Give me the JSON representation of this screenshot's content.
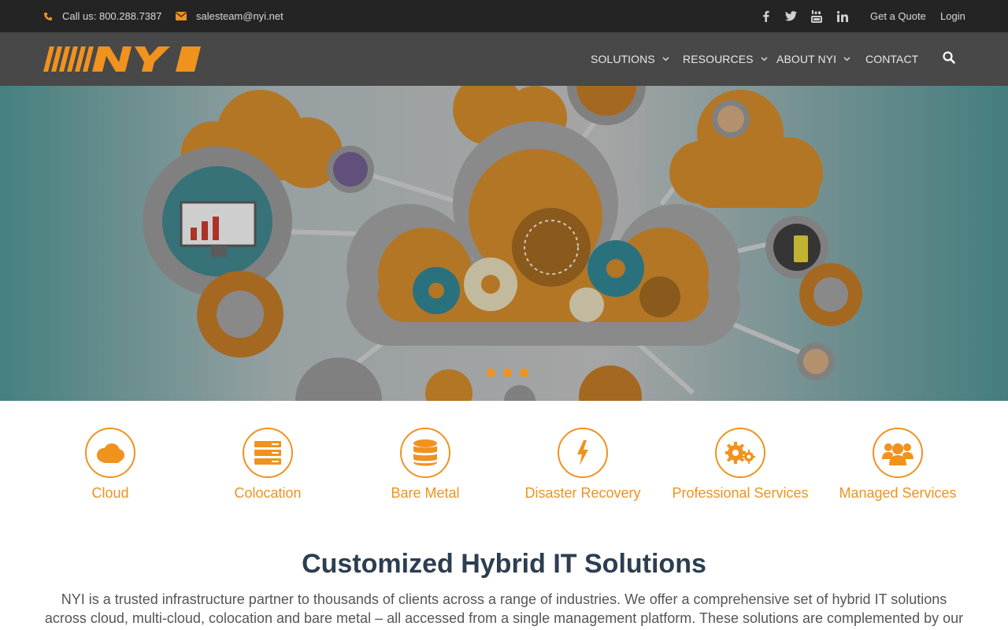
{
  "topbar": {
    "phone": "Call us: 800.288.7387",
    "email": "salesteam@nyi.net",
    "quote": "Get a Quote",
    "login": "Login",
    "social_icons": [
      "facebook-icon",
      "twitter-icon",
      "youtube-icon",
      "linkedin-icon"
    ]
  },
  "logo": {
    "text": "NYI"
  },
  "nav": {
    "solutions": "SOLUTIONS",
    "resources": "RESOURCES",
    "about": "ABOUT NYI",
    "contact": "CONTACT"
  },
  "hero": {
    "slides": 3,
    "active_slide": 1
  },
  "services": [
    {
      "label": "Cloud",
      "icon": "cloud-icon"
    },
    {
      "label": "Colocation",
      "icon": "server-icon"
    },
    {
      "label": "Bare Metal",
      "icon": "database-icon"
    },
    {
      "label": "Disaster Recovery",
      "icon": "bolt-icon"
    },
    {
      "label": "Professional Services",
      "icon": "gears-icon"
    },
    {
      "label": "Managed Services",
      "icon": "users-icon"
    }
  ],
  "intro": {
    "title": "Customized Hybrid IT Solutions",
    "text": "NYI is a trusted infrastructure partner to thousands of clients across a range of industries. We offer a comprehensive set of hybrid IT solutions across cloud, multi-cloud, colocation and bare metal – all accessed from a single management platform. These solutions are complemented by our extensive"
  },
  "colors": {
    "accent": "#f0921e",
    "topbar": "#242424",
    "navbar": "#484848",
    "title": "#2c3e50"
  }
}
